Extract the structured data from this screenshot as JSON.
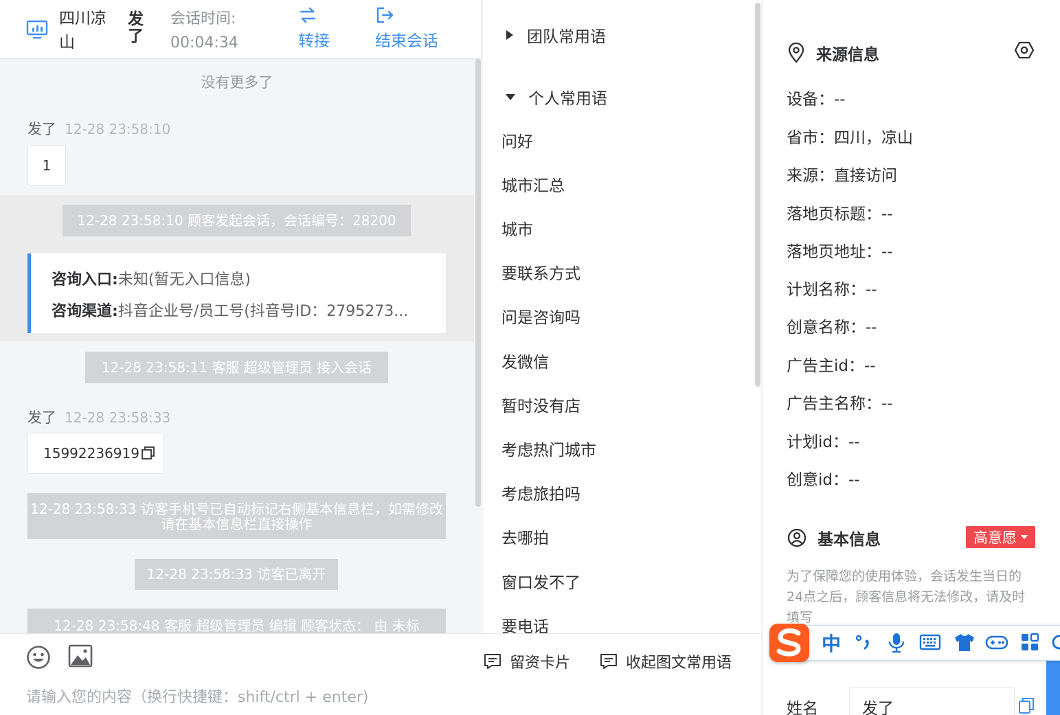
{
  "header": {
    "region": "四川凉山",
    "visitor_name": "发了",
    "session_time_label": "会话时间:",
    "session_time": "00:04:34",
    "transfer_label": "转接",
    "end_label": "结束会话"
  },
  "chat": {
    "no_more": "没有更多了",
    "messages": [
      {
        "sender": "发了",
        "time": "12-28 23:58:10",
        "text": "1"
      },
      {
        "sender": "发了",
        "time": "12-28 23:58:33",
        "text": "15992236919"
      }
    ],
    "system_notes": [
      "12-28 23:58:10 顾客发起会话，会话编号：28200",
      "12-28 23:58:11 客服 超级管理员 接入会话",
      "12-28 23:58:33 访客手机号已自动标记右侧基本信息栏，如需修改请在基本信息栏直接操作",
      "12-28 23:58:33 访客已离开",
      "12-28 23:58:48 客服 超级管理员 编辑 顾客状态：  由 未标"
    ],
    "consult_card": {
      "entry_label": "咨询入口:",
      "entry_value": "未知(暂无入口信息)",
      "channel_label": "咨询渠道:",
      "channel_value": "抖音企业号/员工号(抖音号ID：2795273..."
    }
  },
  "input": {
    "placeholder": "请输入您的内容（换行快捷键：shift/ctrl + enter)",
    "card_label": "留资卡片",
    "collapse_label": "收起图文常用语",
    "icons": [
      "smile-icon",
      "image-icon"
    ]
  },
  "phrases": {
    "team_group": "团队常用语",
    "personal_group": "个人常用语",
    "items": [
      "问好",
      "城市汇总",
      "城市",
      "要联系方式",
      "问是咨询吗",
      "发微信",
      "暂时没有店",
      "考虑热门城市",
      "考虑旅拍吗",
      "去哪拍",
      "窗口发不了",
      "要电话"
    ]
  },
  "info": {
    "source_title": "来源信息",
    "rows": [
      "设备：--",
      "省市：四川，凉山",
      "来源：直接访问",
      "落地页标题：--",
      "落地页地址：--",
      "计划名称：--",
      "创意名称：--",
      "广告主id：--",
      "广告主名称：--",
      "计划id：--",
      "创意id：--"
    ],
    "basic_title": "基本信息",
    "intent_badge": "高意愿",
    "note": "为了保障您的使用体验，会话发生当日的24点之后，顾客信息将无法修改，请及时填写",
    "name_label": "姓名",
    "name_value": "发了"
  },
  "ime": {
    "zh_label": "中"
  },
  "colors": {
    "accent": "#3c8ff0",
    "badge_red": "#f0484c",
    "ime_orange": "#ff5a1f",
    "ime_blue": "#1e72d9"
  }
}
